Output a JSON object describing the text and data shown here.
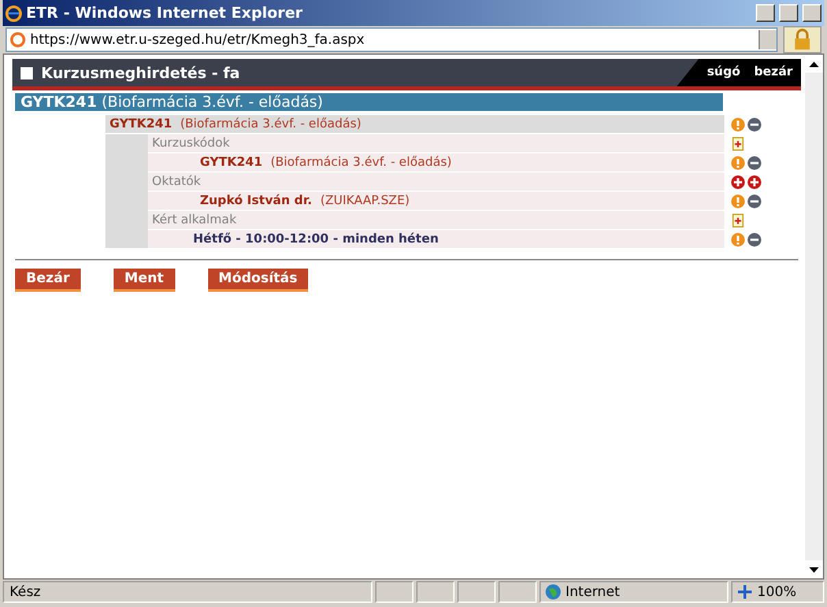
{
  "window": {
    "title": "ETR - Windows Internet Explorer"
  },
  "address_bar": {
    "url": "https://www.etr.u-szeged.hu/etr/Kmegh3_fa.aspx"
  },
  "header": {
    "title": "Kurzusmeghirdetés - fa",
    "links": [
      "súgó",
      "bezár"
    ]
  },
  "course_bar": {
    "code": "GYTK241",
    "name": "(Biofarmácia 3.évf. - előadás)"
  },
  "tree": {
    "code": "GYTK241",
    "name": "(Biofarmácia 3.évf. - előadás)",
    "actions": [
      {
        "kind": "info"
      },
      {
        "kind": "remove"
      }
    ],
    "children": [
      {
        "label": "Kurzuskódok",
        "actions": [
          {
            "kind": "new"
          }
        ],
        "children": [
          {
            "code": "GYTK241",
            "name": "(Biofarmácia 3.évf. - előadás)",
            "actions": [
              {
                "kind": "info"
              },
              {
                "kind": "remove"
              }
            ],
            "kind": "course"
          }
        ]
      },
      {
        "label": "Oktatók",
        "actions": [
          {
            "kind": "add"
          },
          {
            "kind": "add"
          }
        ],
        "children": [
          {
            "code": "Zupkó István dr.",
            "name": "(ZUIKAAP.SZE)",
            "actions": [
              {
                "kind": "info"
              },
              {
                "kind": "remove"
              }
            ],
            "kind": "course"
          }
        ]
      },
      {
        "label": "Kért alkalmak",
        "actions": [
          {
            "kind": "new"
          }
        ],
        "children": [
          {
            "code": "Hétfő - 10:00-12:00 - minden héten",
            "actions": [
              {
                "kind": "info"
              },
              {
                "kind": "remove"
              }
            ],
            "kind": "time"
          }
        ]
      }
    ]
  },
  "buttons": [
    "Bezár",
    "Ment",
    "Módosítás"
  ],
  "status_bar": {
    "text": "Kész",
    "zone": "Internet",
    "zoom": "100%"
  }
}
